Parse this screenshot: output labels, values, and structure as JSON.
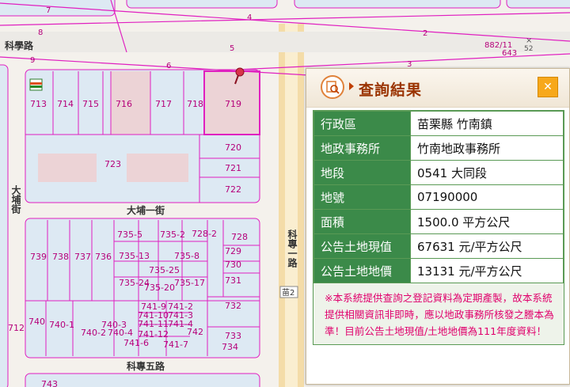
{
  "map": {
    "road_labels": {
      "kexue_road": "科學路",
      "dapu_st": "大埔街",
      "dapu_1st": "大埔一街",
      "kezhuan_1st": "科專一路",
      "kezhuan_5th": "科專五路",
      "miao2": "苗2"
    },
    "line_labels": [
      "7",
      "4",
      "8",
      "5",
      "9",
      "6",
      "2",
      "3"
    ],
    "ref_labels": {
      "a": "882/11",
      "b": "643",
      "c": "52"
    },
    "parcels": {
      "p713": "713",
      "p714": "714",
      "p715": "715",
      "p716": "716",
      "p717": "717",
      "p718": "718",
      "p719": "719",
      "p720": "720",
      "p721": "721",
      "p722": "722",
      "p723": "723",
      "p7355": "735-5",
      "p7352": "735-2",
      "p7282": "728-2",
      "p728": "728",
      "p729": "729",
      "p730": "730",
      "p731": "731",
      "p732": "732",
      "p733": "733",
      "p734": "734",
      "p739": "739",
      "p738": "738",
      "p737": "737",
      "p736": "736",
      "p73513": "735-13",
      "p7358": "735-8",
      "p73525": "735-25",
      "p73524": "735-24",
      "p73520": "735-20",
      "p73517": "735-17",
      "p7419": "741-9",
      "p7412": "741-2",
      "p74110": "741-10",
      "p7413": "741-3",
      "p74111": "741-11",
      "p7414": "741-4",
      "p74112": "741-12",
      "p7416": "741-6",
      "p7417": "741-7",
      "p742": "742",
      "p740": "740",
      "p7401": "740-1",
      "p7402": "740-2",
      "p7403": "740-3",
      "p7404": "740-4",
      "p712": "712",
      "p743": "743"
    }
  },
  "panel": {
    "title": "查詢結果",
    "close_label": "✕",
    "rows": [
      {
        "key": "行政區",
        "value": "苗栗縣 竹南鎮"
      },
      {
        "key": "地政事務所",
        "value": "竹南地政事務所"
      },
      {
        "key": "地段",
        "value": "0541 大同段"
      },
      {
        "key": "地號",
        "value": "07190000"
      },
      {
        "key": "面積",
        "value": "1500.0 平方公尺"
      },
      {
        "key": "公告土地現值",
        "value": "67631 元/平方公尺"
      },
      {
        "key": "公告土地地價",
        "value": "13131 元/平方公尺"
      }
    ],
    "notice": "※本系統提供查詢之登記資料為定期產製，故本系統提供相關資訊非即時，應以地政事務所核發之謄本為準！目前公告土地現值/土地地價為111年度資料！"
  },
  "colors": {
    "parcel_line": "#e020c0",
    "block_fill": "#dde9f3",
    "road_yellow": "#f4dca8",
    "header_green": "#3b8a49",
    "notice_pink": "#e0006c"
  }
}
